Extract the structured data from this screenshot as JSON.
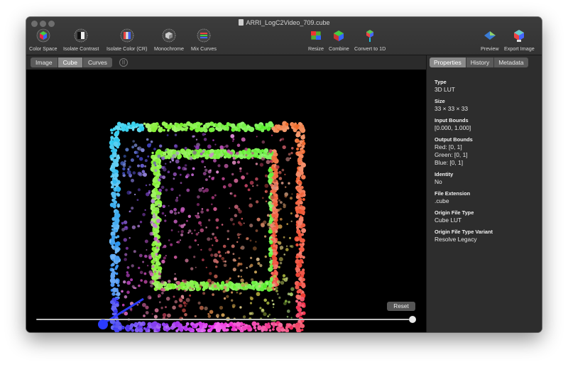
{
  "window": {
    "title": "ARRI_LogC2Video_709.cube"
  },
  "toolbar": {
    "left_tools": [
      {
        "label": "Color Space",
        "icon": "color-space-icon"
      },
      {
        "label": "Isolate Contrast",
        "icon": "isolate-contrast-icon"
      },
      {
        "label": "Isolate Color (CR)",
        "icon": "isolate-color-icon"
      },
      {
        "label": "Monochrome",
        "icon": "monochrome-icon"
      },
      {
        "label": "Mix Curves",
        "icon": "mix-curves-icon"
      }
    ],
    "right_tools": [
      {
        "label": "Resize",
        "icon": "resize-icon"
      },
      {
        "label": "Combine",
        "icon": "combine-icon"
      },
      {
        "label": "Convert to 1D",
        "icon": "convert-1d-icon"
      },
      {
        "label": "Preview",
        "icon": "preview-icon"
      },
      {
        "label": "Export Image",
        "icon": "export-image-icon"
      }
    ]
  },
  "view_modes": {
    "items": [
      "Image",
      "Cube",
      "Curves"
    ],
    "selected": "Cube"
  },
  "inspector_tabs": {
    "items": [
      "Properties",
      "History",
      "Metadata"
    ],
    "selected": "Properties"
  },
  "properties": [
    {
      "key": "Type",
      "values": [
        "3D LUT"
      ]
    },
    {
      "key": "Size",
      "values": [
        "33 × 33 × 33"
      ]
    },
    {
      "key": "Input Bounds",
      "values": [
        "[0.000, 1.000]"
      ]
    },
    {
      "key": "Output Bounds",
      "values": [
        "Red: [0, 1]",
        "Green: [0, 1]",
        "Blue: [0, 1]"
      ]
    },
    {
      "key": "Identity",
      "values": [
        "No"
      ]
    },
    {
      "key": "File Extension",
      "values": [
        ".cube"
      ]
    },
    {
      "key": "Origin File Type",
      "values": [
        "Cube LUT"
      ]
    },
    {
      "key": "Origin File Type Variant",
      "values": [
        "Resolve Legacy"
      ]
    }
  ],
  "viewport": {
    "reset_label": "Reset",
    "rotation_slider": 1.0
  },
  "colors": {
    "accent_blue": "#2a3bff",
    "window_bg": "#1e1e1e"
  }
}
